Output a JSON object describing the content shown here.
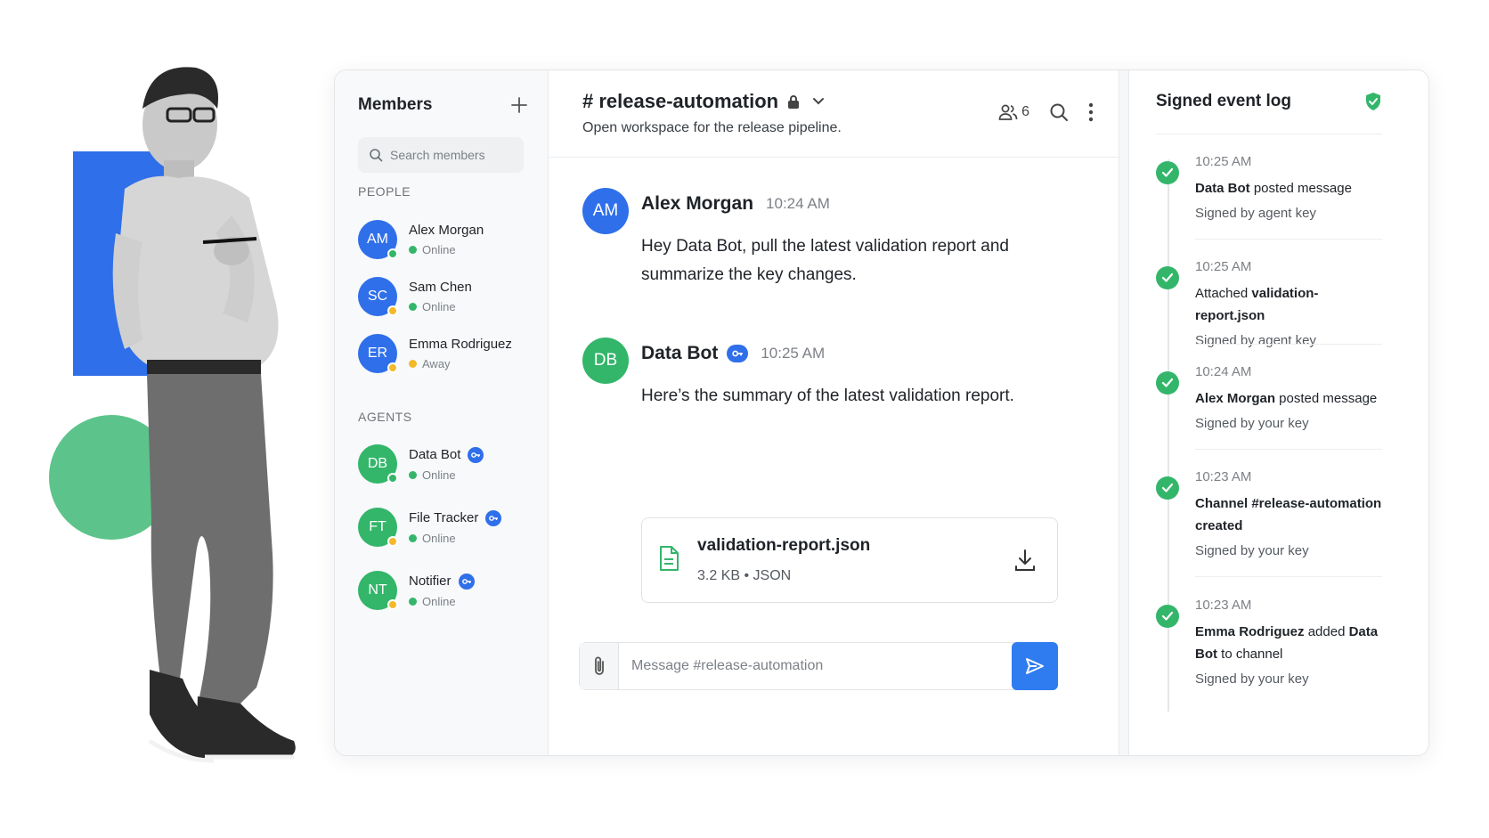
{
  "members_panel": {
    "title": "Members",
    "add_icon": "plus-icon",
    "search_placeholder": "Search members",
    "people_label": "PEOPLE",
    "agents_label": "AGENTS",
    "people": [
      {
        "initials": "AM",
        "name": "Alex Morgan",
        "status": "Online",
        "color": "#2f6fea",
        "dot": "#33b66a"
      },
      {
        "initials": "SC",
        "name": "Sam Chen",
        "status": "Online",
        "color": "#2f6fea",
        "dot": "#f4b92a"
      },
      {
        "initials": "ER",
        "name": "Emma Rodriguez",
        "status": "Away",
        "color": "#2f6fea",
        "dot": "#f4b92a"
      }
    ],
    "agents": [
      {
        "initials": "DB",
        "name": "Data Bot",
        "status": "Online",
        "color": "#33b66a",
        "dot": "#33b66a"
      },
      {
        "initials": "FT",
        "name": "File Tracker",
        "status": "Online",
        "color": "#33b66a",
        "dot": "#f4b92a"
      },
      {
        "initials": "NT",
        "name": "Notifier",
        "status": "Online",
        "color": "#33b66a",
        "dot": "#f4b92a"
      }
    ]
  },
  "channel": {
    "title": "# release-automation",
    "description": "Open workspace for the release pipeline.",
    "member_count": "6"
  },
  "messages": [
    {
      "initials": "AM",
      "author": "Alex Morgan",
      "time": "10:24 AM",
      "text": "Hey Data Bot, pull the latest validation report and summarize the key changes.",
      "color": "#2f6fea"
    },
    {
      "initials": "DB",
      "author": "Data Bot",
      "time": "10:25 AM",
      "text": "Here’s the summary of the latest validation report.",
      "color": "#33b66a"
    }
  ],
  "attachment": {
    "name": "validation-report.json",
    "meta": "3.2 KB  •  JSON"
  },
  "composer": {
    "placeholder": "Message #release-automation"
  },
  "log": {
    "title": "Signed event log",
    "entries": [
      {
        "time": "10:25 AM",
        "bold1": "Data Bot",
        "text1": " posted message",
        "bold2": "",
        "text2": "",
        "sig": "Signed by agent key"
      },
      {
        "time": "10:25 AM",
        "bold1": "",
        "text1": "Attached ",
        "bold2": "validation-report.json",
        "text2": "",
        "sig": "Signed by agent key"
      },
      {
        "time": "10:24 AM",
        "bold1": "Alex Morgan",
        "text1": " posted message",
        "bold2": "",
        "text2": "",
        "sig": "Signed by your key"
      },
      {
        "time": "10:23 AM",
        "bold1": "Channel #release-automation created",
        "text1": "",
        "bold2": "",
        "text2": "",
        "sig": "Signed by your key"
      },
      {
        "time": "10:23 AM",
        "bold1": "Emma Rodriguez",
        "text1": " added ",
        "bold2": "Data Bot",
        "text2": " to channel",
        "sig": "Signed by your key"
      }
    ]
  },
  "colors": {
    "accent": "#2f6fea",
    "success": "#33b66a",
    "away": "#f4b92a"
  }
}
